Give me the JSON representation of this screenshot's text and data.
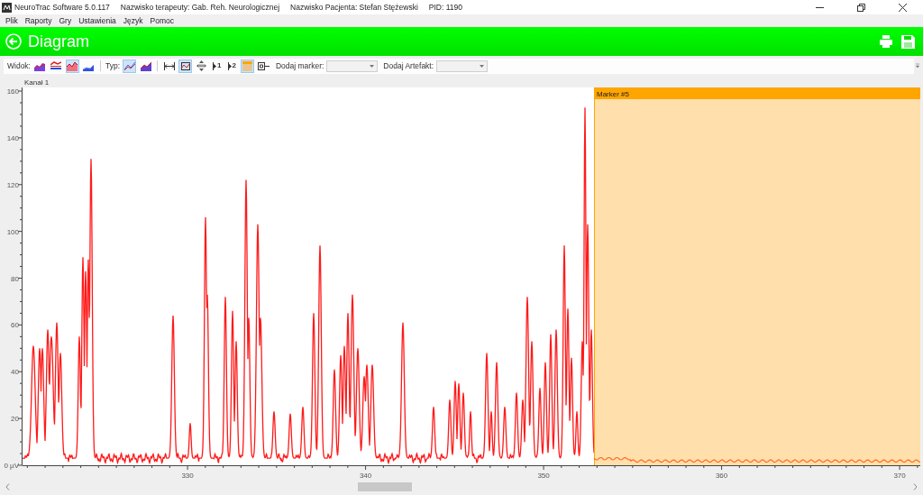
{
  "window": {
    "title": "NeuroTrac Software 5.0.117",
    "therapist": "Nazwisko terapeuty: Gab. Reh. Neurologicznej",
    "patient": "Nazwisko Pacjenta: Stefan Stężewski",
    "pid": "PID: 1190"
  },
  "menu": [
    "Plik",
    "Raporty",
    "Gry",
    "Ustawienia",
    "Język",
    "Pomoc"
  ],
  "header": {
    "title": "Diagram"
  },
  "toolbar": {
    "view_label": "Widok:",
    "view_buttons": [
      {
        "selected": false
      },
      {
        "selected": false
      },
      {
        "selected": true
      },
      {
        "selected": false
      }
    ],
    "type_label": "Typ:",
    "type_buttons": [
      {
        "selected": true
      },
      {
        "selected": false
      }
    ],
    "tools": [
      {
        "kind": "fit-width",
        "selected": false
      },
      {
        "kind": "zoom-fit",
        "selected": true
      },
      {
        "kind": "auto",
        "selected": false
      },
      {
        "kind": "marker",
        "label": "1",
        "selected": false
      },
      {
        "kind": "marker",
        "label": "2",
        "selected": false
      },
      {
        "kind": "area",
        "selected": true
      },
      {
        "kind": "plug",
        "selected": false
      }
    ],
    "marker_label": "Dodaj marker:",
    "artifact_label": "Dodaj Artefakt:"
  },
  "chart": {
    "title": "Kanał 1",
    "y_labels": [
      "160",
      "140",
      "120",
      "100",
      "80",
      "60",
      "40",
      "20",
      "0 µV"
    ],
    "x_labels": [
      "330",
      "340",
      "350",
      "360",
      "370"
    ],
    "marker": {
      "label": "Marker #5"
    }
  }
}
